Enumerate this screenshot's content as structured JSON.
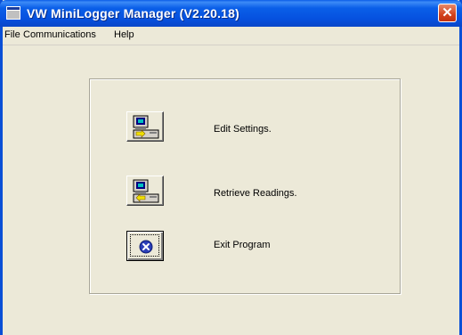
{
  "window": {
    "title": "VW MiniLogger Manager (V2.20.18)",
    "close_glyph": "✕"
  },
  "menu": {
    "items": [
      {
        "label": "File"
      },
      {
        "label": "Communications"
      },
      {
        "label": "Help"
      }
    ]
  },
  "actions": [
    {
      "label": "Edit Settings.",
      "icon": "computer-edit-icon"
    },
    {
      "label": "Retrieve Readings.",
      "icon": "computer-retrieve-icon"
    },
    {
      "label": "Exit Program",
      "icon": "exit-icon"
    }
  ],
  "colors": {
    "title_bar": "#0a5fe8",
    "window_face": "#ece9d8",
    "close_button": "#d2431d",
    "exit_icon": "#2b3fb8"
  }
}
